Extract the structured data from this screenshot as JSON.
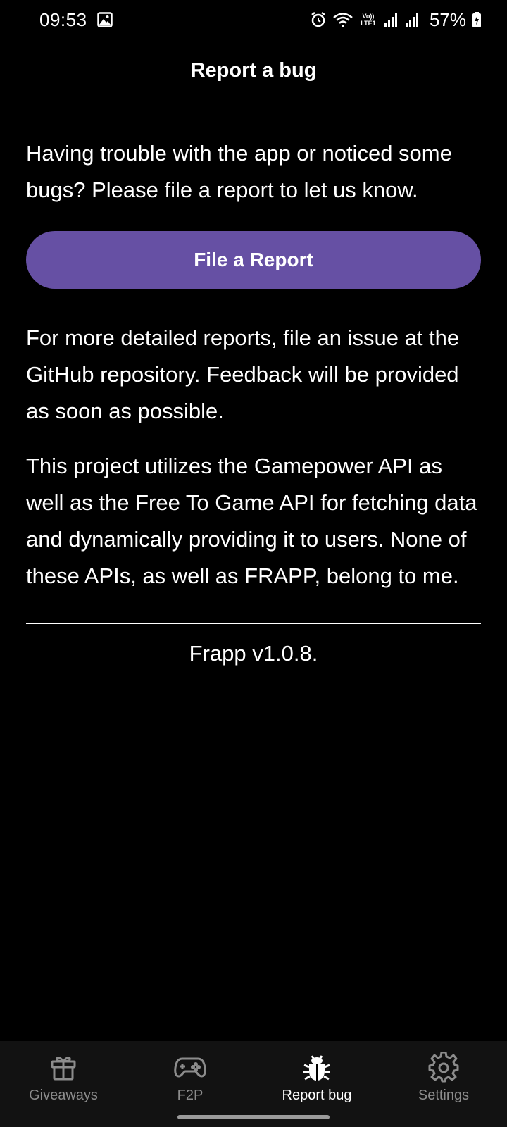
{
  "status_bar": {
    "time": "09:53",
    "lte_label_top": "Vo))",
    "lte_label_bottom": "LTE1",
    "battery_percent": "57%"
  },
  "header": {
    "title": "Report a bug"
  },
  "main": {
    "intro_text": "Having trouble with the app or noticed some bugs? Please file a report to let us know.",
    "report_button_label": "File a Report",
    "github_text": "For more detailed reports, file an issue at the GitHub repository. Feedback will be provided as soon as possible.",
    "api_text": "This project utilizes the Gamepower API as well as the Free To Game API for fetching data and dynamically providing it to users. None of these APIs, as well as FRAPP, belong to me.",
    "version_text": "Frapp v1.0.8."
  },
  "bottom_nav": {
    "items": [
      {
        "label": "Giveaways",
        "icon": "gift-icon",
        "active": false
      },
      {
        "label": "F2P",
        "icon": "gamepad-icon",
        "active": false
      },
      {
        "label": "Report bug",
        "icon": "bug-icon",
        "active": true
      },
      {
        "label": "Settings",
        "icon": "gear-icon",
        "active": false
      }
    ]
  },
  "colors": {
    "background": "#000000",
    "accent_button": "#6650a4",
    "nav_background": "#121212",
    "nav_inactive": "#8c8c8c",
    "nav_active": "#ffffff"
  }
}
